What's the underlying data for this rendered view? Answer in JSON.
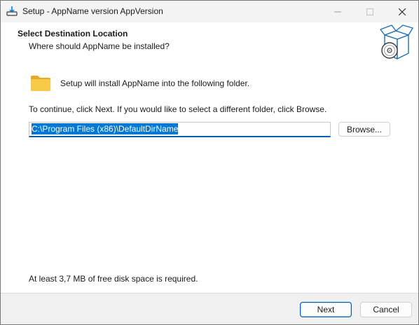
{
  "window": {
    "title": "Setup - AppName version AppVersion"
  },
  "header": {
    "title": "Select Destination Location",
    "subtitle": "Where should AppName be installed?"
  },
  "content": {
    "install_text": "Setup will install AppName into the following folder.",
    "continue_text": "To continue, click Next. If you would like to select a different folder, click Browse.",
    "path_value": "C:\\Program Files (x86)\\DefaultDirName",
    "browse_label": "Browse...",
    "disk_space_text": "At least 3,7 MB of free disk space is required."
  },
  "footer": {
    "next_label": "Next",
    "cancel_label": "Cancel"
  },
  "colors": {
    "accent": "#005fb8",
    "selection": "#0078d4",
    "folder": "#f5c040"
  },
  "icons": [
    "installer-icon",
    "minimize-icon",
    "maximize-icon",
    "close-icon",
    "setup-box-icon",
    "folder-icon"
  ]
}
